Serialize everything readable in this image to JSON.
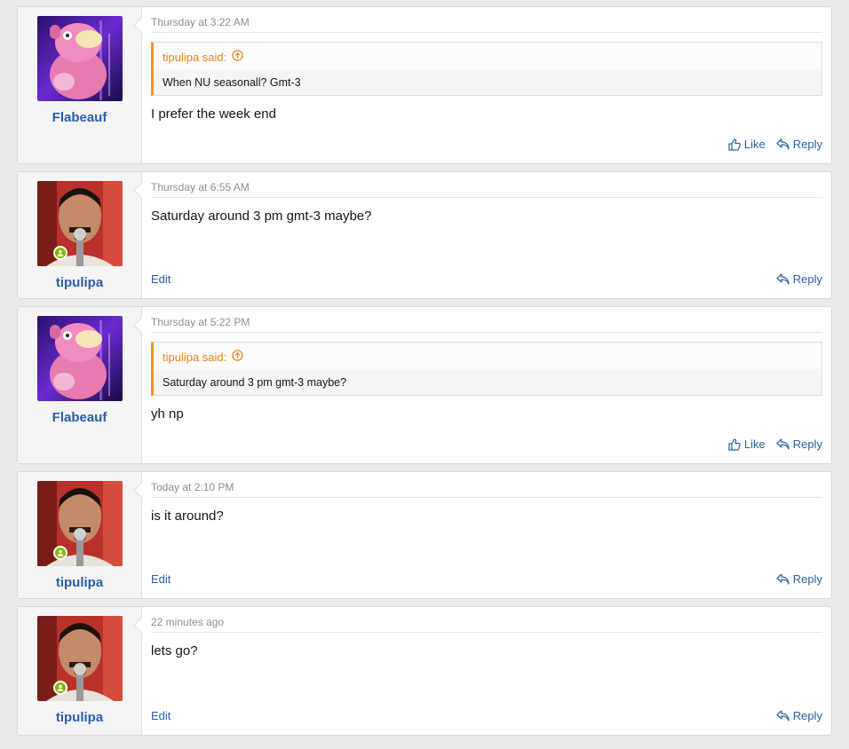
{
  "posts": [
    {
      "author": "Flabeauf",
      "avatar": "slowpoke-avatar",
      "online": false,
      "time": "Thursday at 3:22 AM",
      "quote": {
        "author": "tipulipa said:",
        "text": "When NU seasonall? Gmt-3"
      },
      "message": "I prefer the week end",
      "edit": null,
      "like": "Like",
      "reply": "Reply"
    },
    {
      "author": "tipulipa",
      "avatar": "singer-avatar",
      "online": true,
      "time": "Thursday at 6:55 AM",
      "quote": null,
      "message": "Saturday around 3 pm gmt-3 maybe?",
      "edit": "Edit",
      "like": null,
      "reply": "Reply"
    },
    {
      "author": "Flabeauf",
      "avatar": "slowpoke-avatar",
      "online": false,
      "time": "Thursday at 5:22 PM",
      "quote": {
        "author": "tipulipa said:",
        "text": "Saturday around 3 pm gmt-3 maybe?"
      },
      "message": "yh np",
      "edit": null,
      "like": "Like",
      "reply": "Reply"
    },
    {
      "author": "tipulipa",
      "avatar": "singer-avatar",
      "online": true,
      "time": "Today at 2:10 PM",
      "quote": null,
      "message": "is it around?",
      "edit": "Edit",
      "like": null,
      "reply": "Reply"
    },
    {
      "author": "tipulipa",
      "avatar": "singer-avatar",
      "online": true,
      "time": "22 minutes ago",
      "quote": null,
      "message": "lets go?",
      "edit": "Edit",
      "like": null,
      "reply": "Reply"
    }
  ],
  "colors": {
    "link": "#2a5ea3",
    "quote_accent": "#f7951d",
    "online": "#7fb900"
  }
}
